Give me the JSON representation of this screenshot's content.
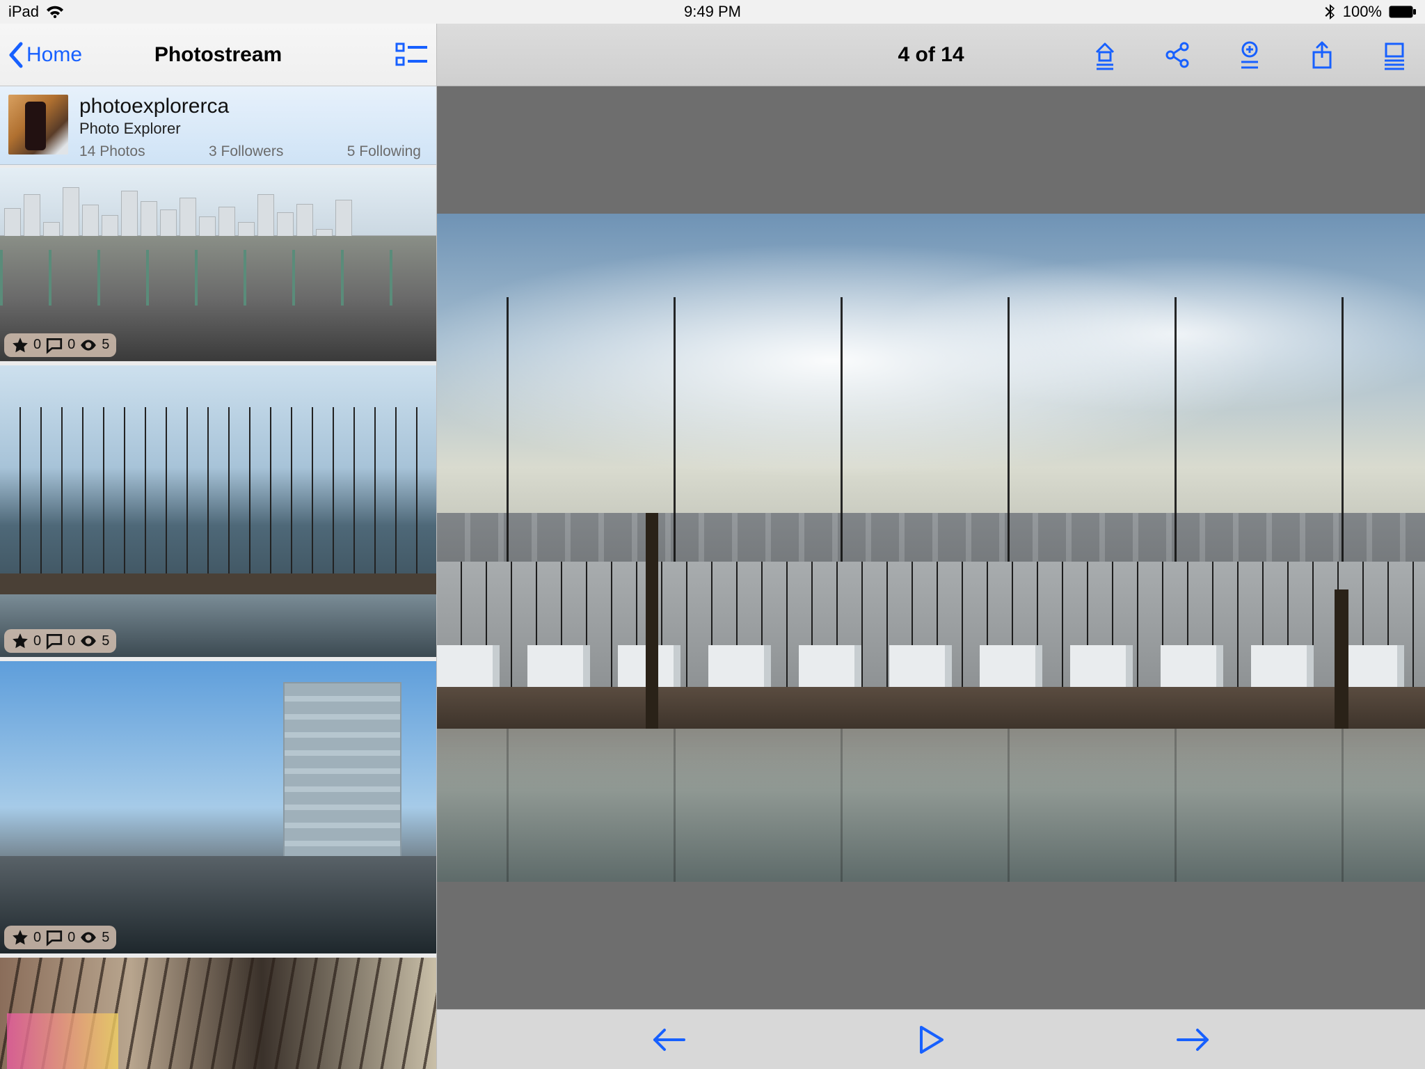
{
  "status_bar": {
    "device": "iPad",
    "time": "9:49 PM",
    "battery_pct": "100%"
  },
  "sidebar": {
    "back_label": "Home",
    "title": "Photostream",
    "profile": {
      "username": "photoexplorerca",
      "display_name": "Photo Explorer",
      "photos_label": "14 Photos",
      "followers_label": "3 Followers",
      "following_label": "5 Following"
    },
    "thumbs": [
      {
        "stars": "0",
        "comments": "0",
        "views": "5"
      },
      {
        "stars": "0",
        "comments": "0",
        "views": "5"
      },
      {
        "stars": "0",
        "comments": "0",
        "views": "5"
      }
    ]
  },
  "detail": {
    "counter": "4 of 14"
  }
}
